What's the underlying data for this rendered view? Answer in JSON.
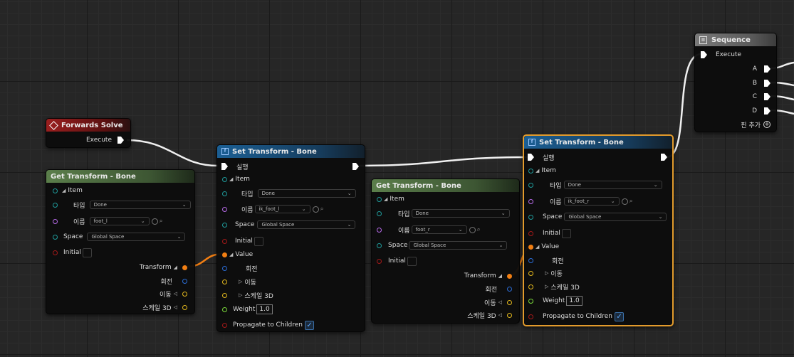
{
  "colors": {
    "exec": "#ffffff",
    "struct": "#1f9b9b",
    "name": "#b66be8",
    "bool": "#a31919",
    "transform": "#f27f13",
    "rotator": "#2b6dd6",
    "vector": "#e3b81d",
    "float": "#7bd93b",
    "selected": "#e39b2c"
  },
  "forwards_solve": {
    "title": "Forwards Solve",
    "execute": "Execute"
  },
  "get1": {
    "title": "Get Transform - Bone",
    "item": "Item",
    "type_label": "타입",
    "type_value": "Done",
    "name_label": "이름",
    "name_value": "foot_l",
    "space_label": "Space",
    "space_value": "Global Space",
    "initial_label": "Initial",
    "transform_out": "Transform",
    "rotation_out": "회전",
    "translation_out": "이동",
    "scale_out": "스케일 3D"
  },
  "set1": {
    "title": "Set Transform - Bone",
    "exec_in": "실행",
    "item": "Item",
    "type_label": "타입",
    "type_value": "Done",
    "name_label": "이름",
    "name_value": "ik_foot_l",
    "space_label": "Space",
    "space_value": "Global Space",
    "initial_label": "Initial",
    "value_label": "Value",
    "rotation": "회전",
    "translation": "이동",
    "scale": "스케일 3D",
    "weight_label": "Weight",
    "weight_value": "1.0",
    "propagate_label": "Propagate to Children"
  },
  "get2": {
    "title": "Get Transform - Bone",
    "item": "Item",
    "type_label": "타입",
    "type_value": "Done",
    "name_label": "이름",
    "name_value": "foot_r",
    "space_label": "Space",
    "space_value": "Global Space",
    "initial_label": "Initial",
    "transform_out": "Transform",
    "rotation_out": "회전",
    "translation_out": "이동",
    "scale_out": "스케일 3D"
  },
  "set2": {
    "title": "Set Transform - Bone",
    "exec_in": "실행",
    "item": "Item",
    "type_label": "타입",
    "type_value": "Done",
    "name_label": "이름",
    "name_value": "ik_foot_r",
    "space_label": "Space",
    "space_value": "Global Space",
    "initial_label": "Initial",
    "value_label": "Value",
    "rotation": "회전",
    "translation": "이동",
    "scale": "스케일 3D",
    "weight_label": "Weight",
    "weight_value": "1.0",
    "propagate_label": "Propagate to Children"
  },
  "sequence": {
    "title": "Sequence",
    "execute": "Execute",
    "outputs": [
      "A",
      "B",
      "C",
      "D"
    ],
    "add_pin": "핀 추가"
  }
}
